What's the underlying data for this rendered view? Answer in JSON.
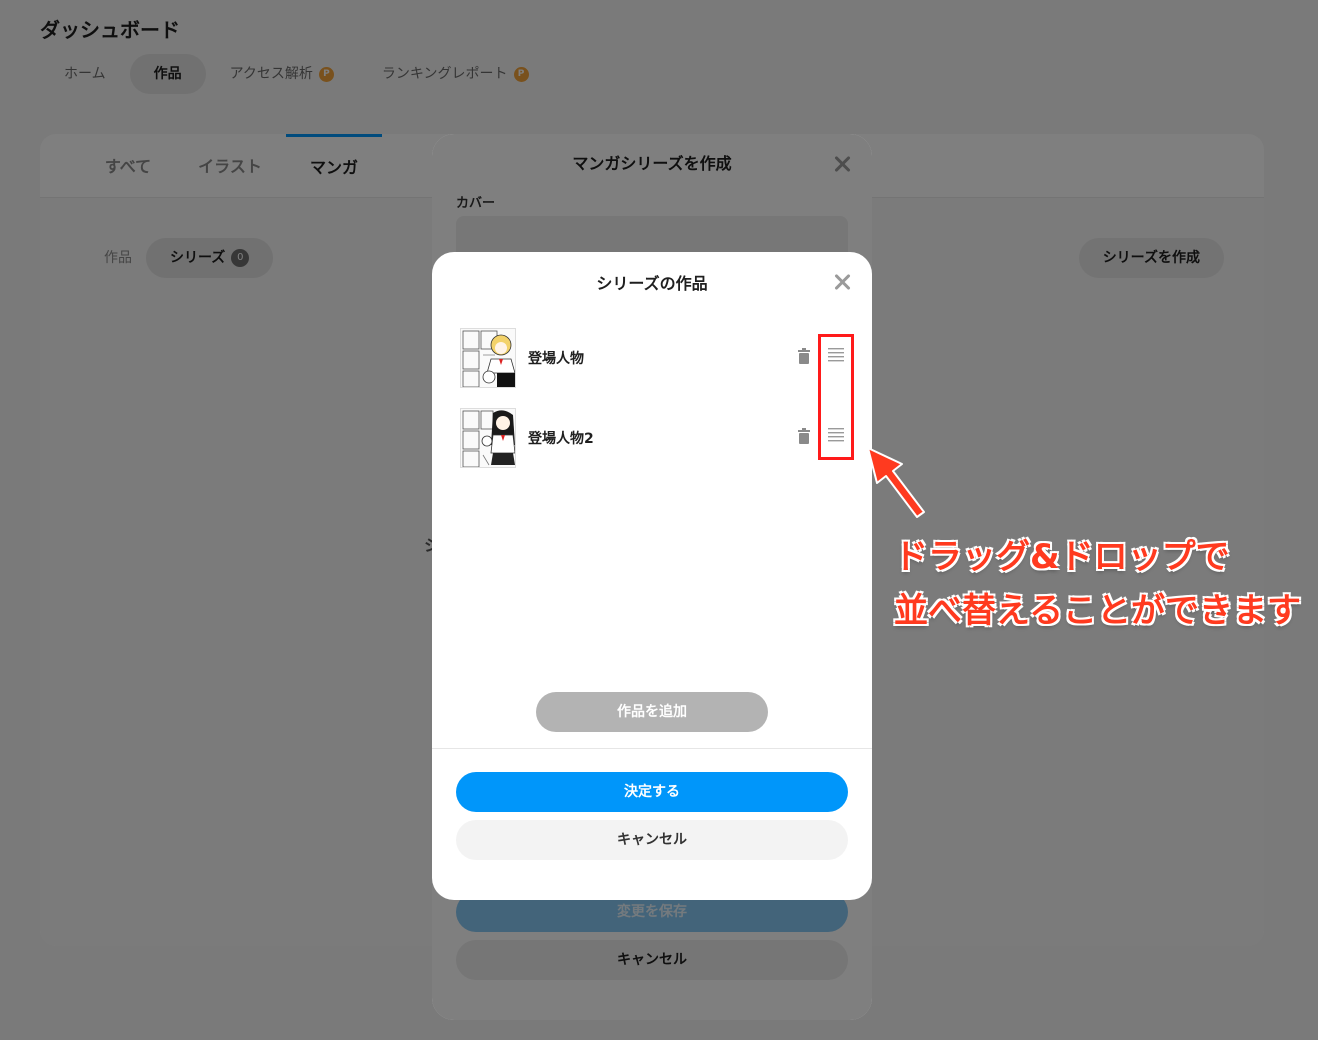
{
  "dashboard": {
    "title": "ダッシュボード",
    "top_tabs": [
      {
        "label": "ホーム"
      },
      {
        "label": "作品"
      },
      {
        "label": "アクセス解析",
        "badge": "P"
      },
      {
        "label": "ランキングレポート",
        "badge": "P"
      }
    ],
    "card_tabs": [
      {
        "label": "すべて"
      },
      {
        "label": "イラスト"
      },
      {
        "label": "マンガ"
      }
    ],
    "sub_tabs": {
      "works_label": "作品",
      "series_label": "シリーズ",
      "series_count": "0"
    },
    "create_series_label": "シリーズを作成",
    "partial_text": "シ"
  },
  "create_modal": {
    "title": "マンガシリーズを作成",
    "cover_label": "カバー",
    "save_label": "変更を保存",
    "cancel_label": "キャンセル"
  },
  "works_modal": {
    "title": "シリーズの作品",
    "items": [
      {
        "title": "登場人物"
      },
      {
        "title": "登場人物2"
      }
    ],
    "add_label": "作品を追加",
    "confirm_label": "決定する",
    "cancel_label": "キャンセル"
  },
  "annotation": {
    "line1": "ドラッグ&ドロップで",
    "line2": "並べ替えることができます"
  },
  "colors": {
    "accent": "#0096fa",
    "annotation_red": "#ff3a1f",
    "badge_orange": "#f2a33a"
  }
}
